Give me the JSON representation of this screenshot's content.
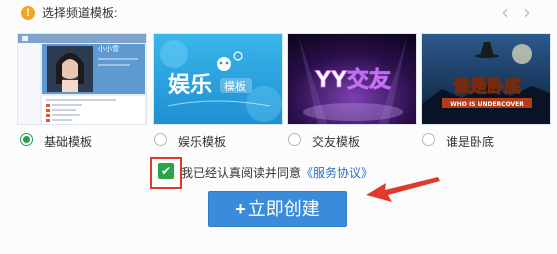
{
  "header": {
    "warn_icon": "!",
    "title": "选择频道模板:",
    "prev_icon": "‹",
    "next_icon": "›"
  },
  "templates": [
    {
      "label": "基础模板",
      "selected": true,
      "thumb_text": "小小雪"
    },
    {
      "label": "娱乐模板",
      "selected": false,
      "thumb_text_main": "娱乐",
      "thumb_text_sub": "模板"
    },
    {
      "label": "交友模板",
      "selected": false,
      "thumb_text": "YY交友"
    },
    {
      "label": "谁是卧底",
      "selected": false,
      "thumb_text_main": "谁是卧底",
      "thumb_text_sub": "WHO IS UNDERCOVER"
    }
  ],
  "agreement": {
    "checked": true,
    "check_mark": "✔",
    "text": "我已经认真阅读并同意",
    "link": "《服务协议》"
  },
  "create_button": {
    "icon": "+",
    "label": "立即创建"
  },
  "colors": {
    "accent": "#3a8bd9",
    "selected_radio": "#22a04a",
    "highlight": "#e23a2a",
    "warning": "#f3a423"
  }
}
